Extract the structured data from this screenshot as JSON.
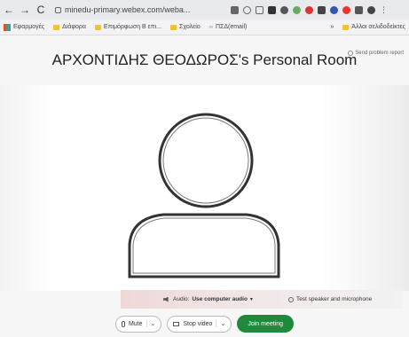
{
  "browser": {
    "back_icon": "arrow-left",
    "forward_icon": "arrow-right",
    "reload_icon": "reload",
    "url": "minedu-primary.webex.com/weba...",
    "bookmarks": [
      "Εφαρμογές",
      "Διάφορα",
      "Επιμόρφωση Β επι...",
      "Σχολείο",
      "ΠΣΔ(email)",
      "Άλλοι σελιδοδείκτες"
    ],
    "bookmarks_more": "»"
  },
  "room": {
    "title": "ΑΡΧΟΝΤΙΔΗΣ ΘΕΟΔΩΡΟΣ's Personal Room",
    "send_report": "Send problem report"
  },
  "audio": {
    "label": "Audio:",
    "value": "Use computer audio",
    "test": "Test speaker and microphone"
  },
  "controls": {
    "mute": "Mute",
    "stop_video": "Stop video",
    "join": "Join meeting"
  },
  "colors": {
    "join_green": "#1f8a3c"
  }
}
